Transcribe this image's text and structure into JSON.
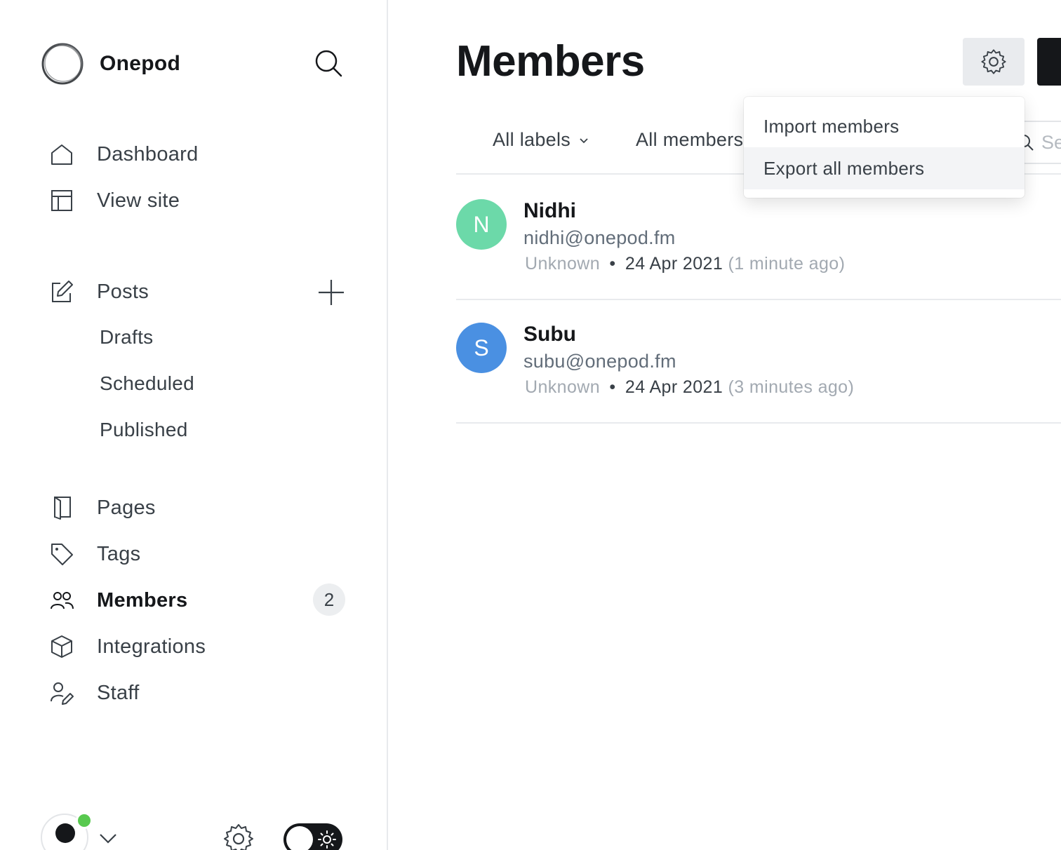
{
  "sidebar": {
    "brand": "Onepod",
    "nav": {
      "dashboard": "Dashboard",
      "view_site": "View site",
      "posts": "Posts",
      "drafts": "Drafts",
      "scheduled": "Scheduled",
      "published": "Published",
      "pages": "Pages",
      "tags": "Tags",
      "members": "Members",
      "members_count": "2",
      "integrations": "Integrations",
      "staff": "Staff"
    },
    "active_item": "Members"
  },
  "main": {
    "title": "Members",
    "filters": {
      "labels": "All labels",
      "members": "All members"
    },
    "search_placeholder": "Se"
  },
  "dropdown": {
    "items": [
      "Import members",
      "Export all members"
    ],
    "highlighted": "Export all members"
  },
  "members": [
    {
      "initial": "N",
      "name": "Nidhi",
      "email": "nidhi@onepod.fm",
      "location": "Unknown",
      "separator": "•",
      "date": "24 Apr 2021",
      "relative": "(1 minute ago)",
      "color": "#6cd9a9"
    },
    {
      "initial": "S",
      "name": "Subu",
      "email": "subu@onepod.fm",
      "location": "Unknown",
      "separator": "•",
      "date": "24 Apr 2021",
      "relative": "(3 minutes ago)",
      "color": "#4a90e2"
    }
  ],
  "colors": {
    "text": "#15171a",
    "muted": "#a2a9b1",
    "online": "#58c94f",
    "accent_dark": "#15171a"
  }
}
